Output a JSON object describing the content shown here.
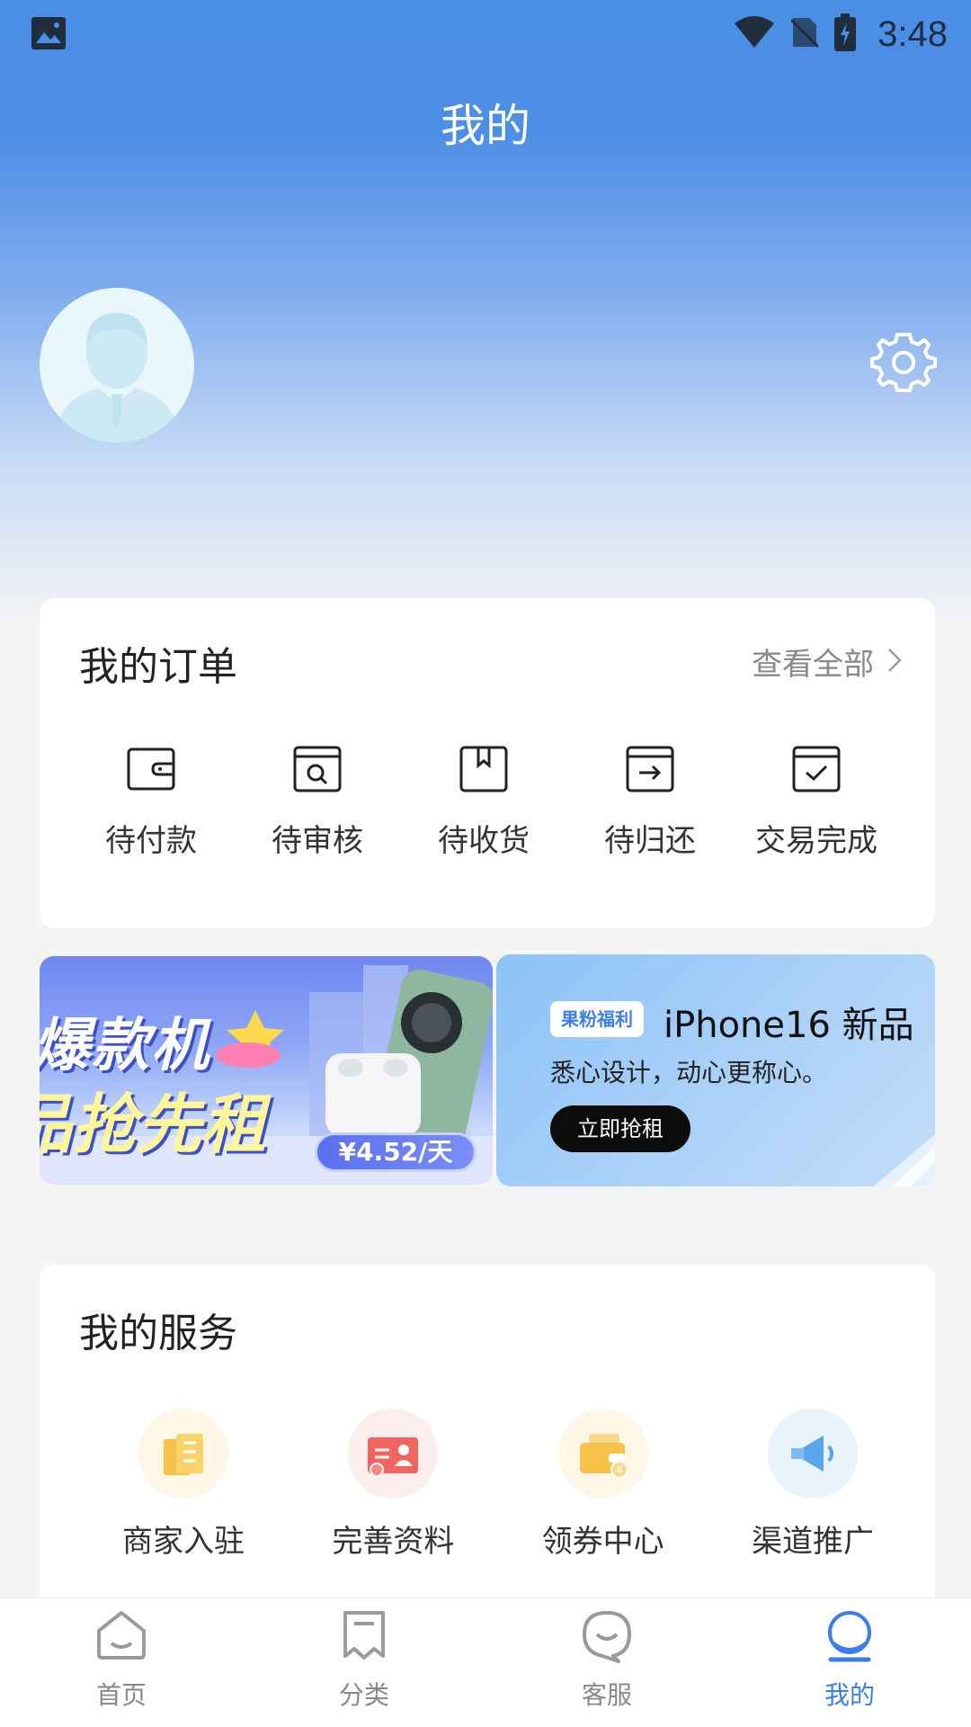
{
  "status_bar": {
    "time": "3:48"
  },
  "header": {
    "title": "我的"
  },
  "orders": {
    "title": "我的订单",
    "view_all": "查看全部",
    "items": [
      {
        "label": "待付款",
        "icon": "wallet-icon"
      },
      {
        "label": "待审核",
        "icon": "review-icon"
      },
      {
        "label": "待收货",
        "icon": "package-icon"
      },
      {
        "label": "待归还",
        "icon": "return-icon"
      },
      {
        "label": "交易完成",
        "icon": "complete-icon"
      }
    ]
  },
  "banners": {
    "left": {
      "line1": "爆款机",
      "line2": "品抢先租",
      "price": "¥4.52/天"
    },
    "right": {
      "badge": "果粉福利",
      "title": "iPhone16 新品",
      "subtitle": "悉心设计，动心更称心。",
      "button": "立即抢租"
    }
  },
  "services": {
    "title": "我的服务",
    "items": [
      {
        "label": "商家入驻",
        "icon": "merchant-icon",
        "bg": "#fff6e6"
      },
      {
        "label": "完善资料",
        "icon": "profile-card-icon",
        "bg": "#fdeeee"
      },
      {
        "label": "领券中心",
        "icon": "coupon-wallet-icon",
        "bg": "#fff6e6"
      },
      {
        "label": "渠道推广",
        "icon": "megaphone-icon",
        "bg": "#e8f3fc"
      }
    ]
  },
  "tabs": [
    {
      "label": "首页",
      "icon": "home-icon",
      "active": false
    },
    {
      "label": "分类",
      "icon": "category-icon",
      "active": false
    },
    {
      "label": "客服",
      "icon": "service-chat-icon",
      "active": false
    },
    {
      "label": "我的",
      "icon": "profile-icon",
      "active": true
    }
  ],
  "colors": {
    "accent": "#3c7ee8",
    "header_blue": "#4a8ee6"
  }
}
